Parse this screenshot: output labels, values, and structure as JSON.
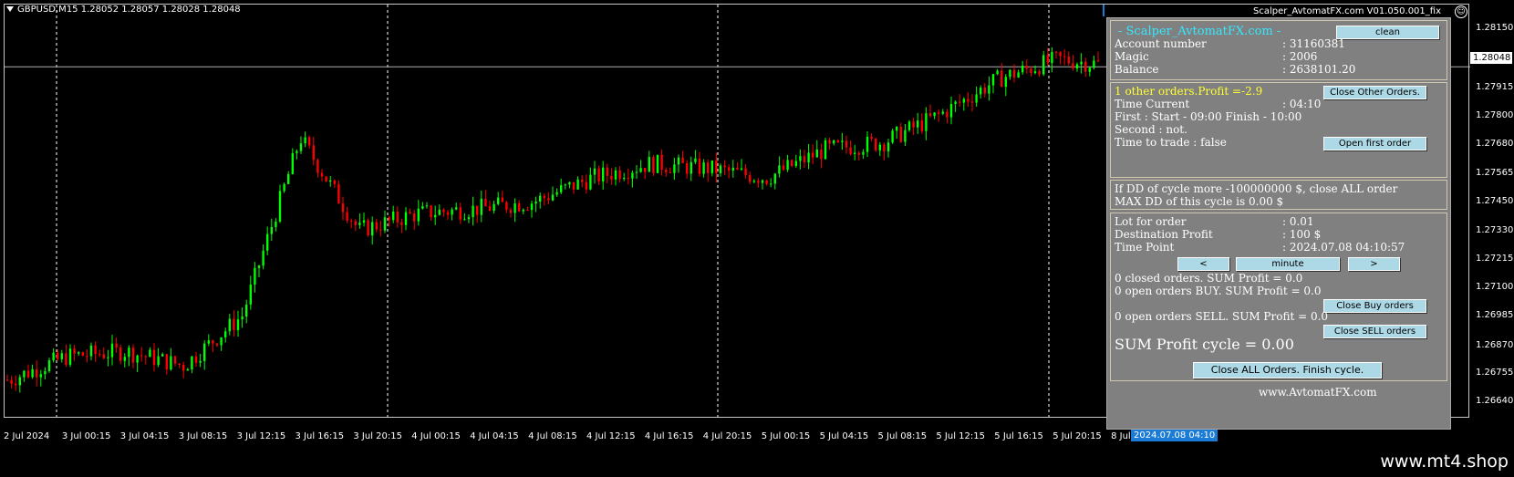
{
  "header": {
    "symbol_info": "GBPUSD,M15  1.28052 1.28057 1.28028 1.28048",
    "ea_title": "Scalper_AvtomatFX.com  V01.050.001_fix",
    "smiley": "☺"
  },
  "price_axis": [
    "1.28150",
    "1.28048",
    "1.27915",
    "1.27800",
    "1.27680",
    "1.27565",
    "1.27450",
    "1.27330",
    "1.27215",
    "1.27100",
    "1.26985",
    "1.26870",
    "1.26755",
    "1.26640"
  ],
  "current_price": "1.28048",
  "time_axis": [
    "2 Jul 2024",
    "3 Jul 00:15",
    "3 Jul 04:15",
    "3 Jul 08:15",
    "3 Jul 12:15",
    "3 Jul 16:15",
    "3 Jul 20:15",
    "4 Jul 00:15",
    "4 Jul 04:15",
    "4 Jul 08:15",
    "4 Jul 12:15",
    "4 Jul 16:15",
    "4 Jul 20:15",
    "5 Jul 00:15",
    "5 Jul 04:15",
    "5 Jul 08:15",
    "5 Jul 12:15",
    "5 Jul 16:15",
    "5 Jul 20:15",
    "8 Jul"
  ],
  "time_axis_highlight": "2024.07.08 04:10",
  "colors": {
    "bull": "#00ff00",
    "bear": "#ff0000",
    "panel_bg": "#808080",
    "button": "#add8e6",
    "accent_cyan": "#33e8ff",
    "accent_yellow": "#ffff33"
  },
  "chart_data": {
    "type": "candlestick",
    "symbol": "GBPUSD",
    "timeframe": "M15",
    "ylim": [
      1.2664,
      1.2821
    ],
    "close_path_approx": [
      {
        "x": "2 Jul 2024",
        "y": 1.2673
      },
      {
        "x": "3 Jul 00:15",
        "y": 1.2683
      },
      {
        "x": "3 Jul 04:15",
        "y": 1.2685
      },
      {
        "x": "3 Jul 08:15",
        "y": 1.2679
      },
      {
        "x": "3 Jul 12:15",
        "y": 1.27
      },
      {
        "x": "3 Jul 16:15",
        "y": 1.2775
      },
      {
        "x": "3 Jul 20:15",
        "y": 1.2736
      },
      {
        "x": "4 Jul 00:15",
        "y": 1.2743
      },
      {
        "x": "4 Jul 04:15",
        "y": 1.2745
      },
      {
        "x": "4 Jul 08:15",
        "y": 1.2748
      },
      {
        "x": "4 Jul 12:15",
        "y": 1.2758
      },
      {
        "x": "4 Jul 16:15",
        "y": 1.2764
      },
      {
        "x": "4 Jul 20:15",
        "y": 1.2762
      },
      {
        "x": "5 Jul 00:15",
        "y": 1.2758
      },
      {
        "x": "5 Jul 04:15",
        "y": 1.277
      },
      {
        "x": "5 Jul 08:15",
        "y": 1.2773
      },
      {
        "x": "5 Jul 12:15",
        "y": 1.2785
      },
      {
        "x": "5 Jul 16:15",
        "y": 1.28
      },
      {
        "x": "5 Jul 20:15",
        "y": 1.2808
      },
      {
        "x": "8 Jul",
        "y": 1.2805
      }
    ],
    "last": 1.28048,
    "grid": "vertical dashed at day separators"
  },
  "panel": {
    "title": " - Scalper_AvtomatFX.com -",
    "clean_btn": "clean",
    "account_label": "Account number",
    "account_value": ": 31160381",
    "magic_label": "Magic",
    "magic_value": ": 2006",
    "balance_label": "Balance",
    "balance_value": ": 2638101.20",
    "other_orders": "1 other orders.Profit =-2.9",
    "close_other_btn": "Close Other Orders.",
    "time_current_label": "Time Current",
    "time_current_value": ": 04:10",
    "first_row": "First      : Start - 09:00       Finish  - 10:00",
    "second_row": "Second  : not.",
    "time_to_trade": "Time to trade :  false",
    "open_first_btn": "Open first order",
    "dd_line1": "If DD of cycle more -100000000 $, close ALL order",
    "dd_line2": "MAX DD of this cycle is 0.00 $",
    "lot_label": "Lot for order",
    "lot_value": ": 0.01",
    "dest_label": "Destination Profit",
    "dest_value": ": 100 $",
    "timepoint_label": "Time Point",
    "timepoint_value": ": 2024.07.08 04:10:57",
    "prev_btn": "<",
    "unit_btn": "minute",
    "next_btn": ">",
    "closed_orders": "0 closed orders. SUM Profit = 0.0",
    "open_buy": "0 open orders BUY. SUM Profit = 0.0",
    "close_buy_btn": "Close Buy orders",
    "open_sell": "0 open orders SELL. SUM Profit = 0.0",
    "close_sell_btn": "Close SELL orders",
    "sum_profit": "SUM Profit cycle = 0.00",
    "close_all_btn": "Close ALL Orders. Finish cycle.",
    "site": "www.AvtomatFX.com"
  },
  "footer": {
    "brand": "www.mt4.shop"
  }
}
